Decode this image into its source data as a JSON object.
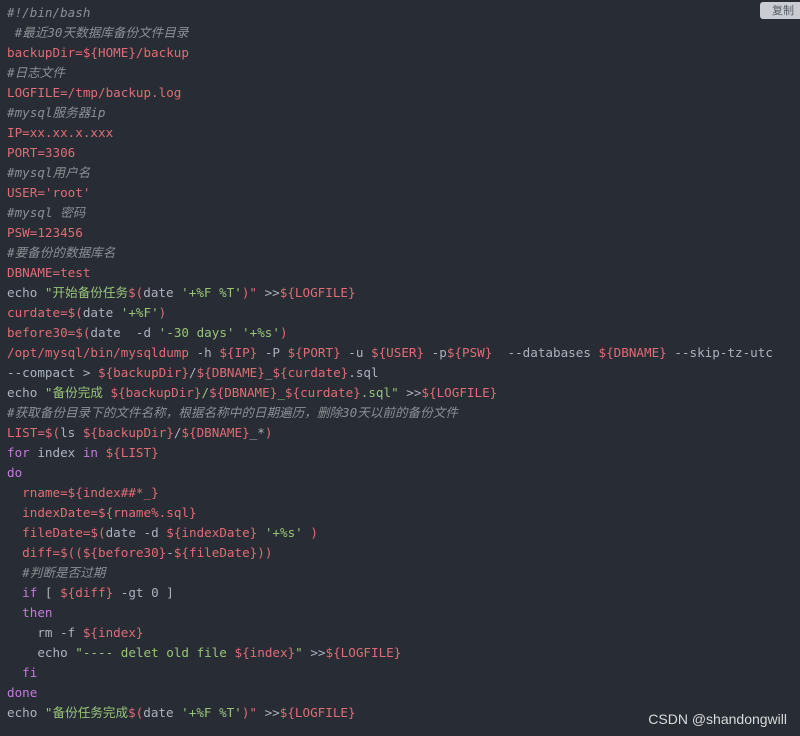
{
  "toolbar": {
    "copy_label": "复制"
  },
  "watermark": {
    "text": "CSDN @shandongwill"
  },
  "colors": {
    "background": "#282c34",
    "comment": "#8b8f96",
    "variable": "#e06c75",
    "keyword": "#c678dd",
    "string": "#98c379",
    "plain": "#c5c8c6"
  },
  "code_lines": [
    [
      {
        "c": "c",
        "t": "#!/bin/bash"
      }
    ],
    [
      {
        "c": "c",
        "t": " #最近30天数据库备份文件目录"
      }
    ],
    [
      {
        "c": "v",
        "t": "backupDir=${HOME}/backup"
      }
    ],
    [
      {
        "c": "c",
        "t": "#日志文件"
      }
    ],
    [
      {
        "c": "v",
        "t": "LOGFILE=/tmp/backup.log"
      }
    ],
    [
      {
        "c": "c",
        "t": "#mysql服务器ip"
      }
    ],
    [
      {
        "c": "v",
        "t": "IP=xx.xx.x.xxx"
      }
    ],
    [
      {
        "c": "v",
        "t": "PORT=3306"
      }
    ],
    [
      {
        "c": "c",
        "t": "#mysql用户名"
      }
    ],
    [
      {
        "c": "v",
        "t": "USER='root'"
      }
    ],
    [
      {
        "c": "c",
        "t": "#mysql 密码"
      }
    ],
    [
      {
        "c": "v",
        "t": "PSW=123456"
      }
    ],
    [
      {
        "c": "c",
        "t": "#要备份的数据库名"
      }
    ],
    [
      {
        "c": "v",
        "t": "DBNAME=test"
      }
    ],
    [
      {
        "c": "t",
        "t": "echo "
      },
      {
        "c": "s",
        "t": "\"开始备份任务"
      },
      {
        "c": "v",
        "t": "$("
      },
      {
        "c": "t",
        "t": "date "
      },
      {
        "c": "s",
        "t": "'+%F %T'"
      },
      {
        "c": "v",
        "t": ")\""
      },
      {
        "c": "t",
        "t": " >>"
      },
      {
        "c": "v",
        "t": "${LOGFILE}"
      }
    ],
    [
      {
        "c": "v",
        "t": "curdate=$("
      },
      {
        "c": "t",
        "t": "date "
      },
      {
        "c": "s",
        "t": "'+%F'"
      },
      {
        "c": "v",
        "t": ")"
      }
    ],
    [
      {
        "c": "v",
        "t": "before30=$("
      },
      {
        "c": "t",
        "t": "date  -d "
      },
      {
        "c": "s",
        "t": "'-30 days' '+%s'"
      },
      {
        "c": "v",
        "t": ")"
      }
    ],
    [
      {
        "c": "v",
        "t": "/opt/mysql/bin/mysqldump"
      },
      {
        "c": "t",
        "t": " -h "
      },
      {
        "c": "v",
        "t": "${IP}"
      },
      {
        "c": "t",
        "t": " -P "
      },
      {
        "c": "v",
        "t": "${PORT}"
      },
      {
        "c": "t",
        "t": " -u "
      },
      {
        "c": "v",
        "t": "${USER}"
      },
      {
        "c": "t",
        "t": " -p"
      },
      {
        "c": "v",
        "t": "${PSW}"
      },
      {
        "c": "t",
        "t": "  --databases "
      },
      {
        "c": "v",
        "t": "${DBNAME}"
      },
      {
        "c": "t",
        "t": " --skip-tz-utc"
      }
    ],
    [
      {
        "c": "t",
        "t": "--compact > "
      },
      {
        "c": "v",
        "t": "${backupDir}"
      },
      {
        "c": "t",
        "t": "/"
      },
      {
        "c": "v",
        "t": "${DBNAME}"
      },
      {
        "c": "t",
        "t": "_"
      },
      {
        "c": "v",
        "t": "${curdate}"
      },
      {
        "c": "t",
        "t": ".sql"
      }
    ],
    [
      {
        "c": "t",
        "t": "echo "
      },
      {
        "c": "s",
        "t": "\"备份完成 "
      },
      {
        "c": "v",
        "t": "${backupDir}"
      },
      {
        "c": "s",
        "t": "/"
      },
      {
        "c": "v",
        "t": "${DBNAME}"
      },
      {
        "c": "s",
        "t": "_"
      },
      {
        "c": "v",
        "t": "${curdate}"
      },
      {
        "c": "s",
        "t": ".sql\""
      },
      {
        "c": "t",
        "t": " >>"
      },
      {
        "c": "v",
        "t": "${LOGFILE}"
      }
    ],
    [
      {
        "c": "c",
        "t": "#获取备份目录下的文件名称，根据名称中的日期遍历，删除30天以前的备份文件"
      }
    ],
    [
      {
        "c": "v",
        "t": "LIST=$("
      },
      {
        "c": "t",
        "t": "ls "
      },
      {
        "c": "v",
        "t": "${backupDir}"
      },
      {
        "c": "t",
        "t": "/"
      },
      {
        "c": "v",
        "t": "${DBNAME}"
      },
      {
        "c": "t",
        "t": "_*"
      },
      {
        "c": "v",
        "t": ")"
      }
    ],
    [
      {
        "c": "k",
        "t": "for"
      },
      {
        "c": "t",
        "t": " index "
      },
      {
        "c": "k",
        "t": "in"
      },
      {
        "c": "t",
        "t": " "
      },
      {
        "c": "v",
        "t": "${LIST}"
      }
    ],
    [
      {
        "c": "k",
        "t": "do"
      }
    ],
    [
      {
        "c": "t",
        "t": "  "
      },
      {
        "c": "v",
        "t": "rname=${index##*_}"
      }
    ],
    [
      {
        "c": "t",
        "t": "  "
      },
      {
        "c": "v",
        "t": "indexDate=${rname%.sql}"
      }
    ],
    [
      {
        "c": "t",
        "t": "  "
      },
      {
        "c": "v",
        "t": "fileDate=$("
      },
      {
        "c": "t",
        "t": "date -d "
      },
      {
        "c": "v",
        "t": "${indexDate}"
      },
      {
        "c": "t",
        "t": " "
      },
      {
        "c": "s",
        "t": "'+%s'"
      },
      {
        "c": "t",
        "t": " "
      },
      {
        "c": "v",
        "t": ")"
      }
    ],
    [
      {
        "c": "t",
        "t": "  "
      },
      {
        "c": "v",
        "t": "diff=$(("
      },
      {
        "c": "v",
        "t": "${before30}"
      },
      {
        "c": "t",
        "t": "-"
      },
      {
        "c": "v",
        "t": "${fileDate}"
      },
      {
        "c": "v",
        "t": "))"
      }
    ],
    [
      {
        "c": "t",
        "t": "  "
      },
      {
        "c": "c",
        "t": "#判断是否过期"
      }
    ],
    [
      {
        "c": "t",
        "t": "  "
      },
      {
        "c": "k",
        "t": "if"
      },
      {
        "c": "t",
        "t": " [ "
      },
      {
        "c": "v",
        "t": "${diff}"
      },
      {
        "c": "t",
        "t": " -gt 0 ]"
      }
    ],
    [
      {
        "c": "t",
        "t": "  "
      },
      {
        "c": "k",
        "t": "then"
      }
    ],
    [
      {
        "c": "t",
        "t": "    rm -f "
      },
      {
        "c": "v",
        "t": "${index}"
      }
    ],
    [
      {
        "c": "t",
        "t": "    echo "
      },
      {
        "c": "s",
        "t": "\"---- delet old file "
      },
      {
        "c": "v",
        "t": "${index}"
      },
      {
        "c": "s",
        "t": "\""
      },
      {
        "c": "t",
        "t": " >>"
      },
      {
        "c": "v",
        "t": "${LOGFILE}"
      }
    ],
    [
      {
        "c": "t",
        "t": "  "
      },
      {
        "c": "k",
        "t": "fi"
      }
    ],
    [
      {
        "c": "k",
        "t": "done"
      }
    ],
    [
      {
        "c": "t",
        "t": "echo "
      },
      {
        "c": "s",
        "t": "\"备份任务完成"
      },
      {
        "c": "v",
        "t": "$("
      },
      {
        "c": "t",
        "t": "date "
      },
      {
        "c": "s",
        "t": "'+%F %T'"
      },
      {
        "c": "v",
        "t": ")\""
      },
      {
        "c": "t",
        "t": " >>"
      },
      {
        "c": "v",
        "t": "${LOGFILE}"
      }
    ]
  ]
}
